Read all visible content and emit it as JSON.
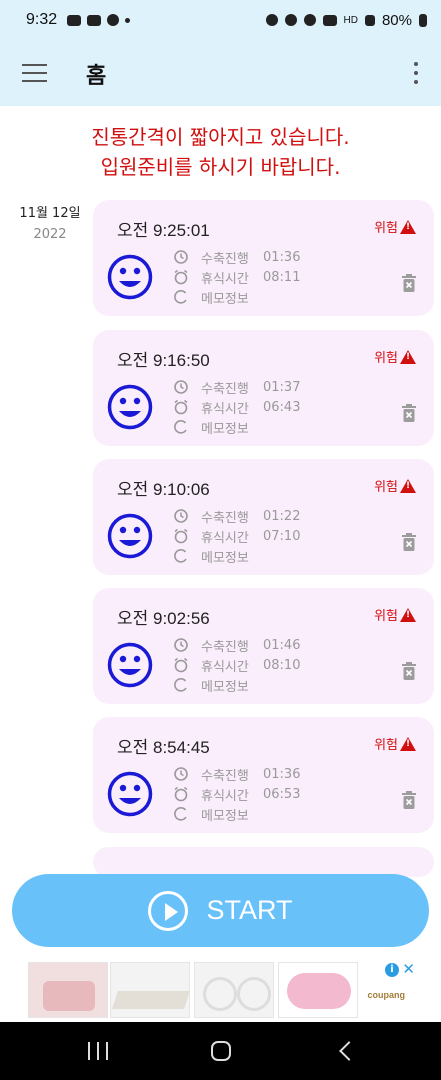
{
  "status": {
    "time": "9:32",
    "battery": "80%",
    "network": "HD"
  },
  "appbar": {
    "title": "홈"
  },
  "banner": {
    "line1": "진통간격이 짧아지고 있습니다.",
    "line2": "입원준비를 하시기 바랍니다."
  },
  "date": {
    "month_day": "11월 12일",
    "year": "2022"
  },
  "labels": {
    "contraction": "수축진행",
    "rest": "휴식시간",
    "memo": "메모정보",
    "risk": "위험"
  },
  "entries": [
    {
      "time": "오전 9:25:01",
      "contraction": "01:36",
      "rest": "08:11"
    },
    {
      "time": "오전 9:16:50",
      "contraction": "01:37",
      "rest": "06:43"
    },
    {
      "time": "오전 9:10:06",
      "contraction": "01:22",
      "rest": "07:10"
    },
    {
      "time": "오전 9:02:56",
      "contraction": "01:46",
      "rest": "08:10"
    },
    {
      "time": "오전 8:54:45",
      "contraction": "01:36",
      "rest": "06:53"
    }
  ],
  "start_button": {
    "label": "START"
  },
  "ad": {
    "brand": "coupang"
  },
  "colors": {
    "accent": "#69c1f9",
    "warning": "#d20f0f",
    "card": "#fbeefc",
    "smiley": "#1a1ad6"
  }
}
